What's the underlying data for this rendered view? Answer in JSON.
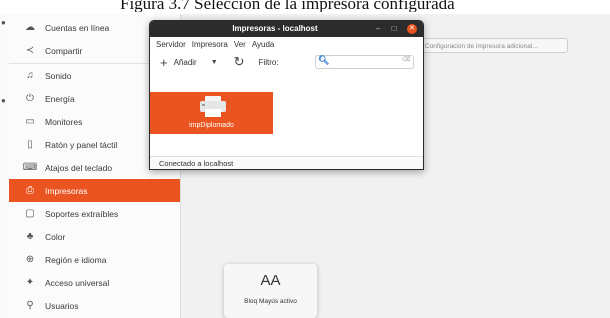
{
  "caption": "Figura 3.7 Selección de la impresora configurada",
  "sidebar": {
    "items": [
      {
        "label": "Cuentas en línea",
        "icon": "cloud-icon"
      },
      {
        "label": "Compartir",
        "icon": "share-icon"
      },
      {
        "label": "Sonido",
        "icon": "music-note-icon"
      },
      {
        "label": "Energía",
        "icon": "power-icon"
      },
      {
        "label": "Monitores",
        "icon": "monitor-icon"
      },
      {
        "label": "Ratón y panel táctil",
        "icon": "mouse-icon"
      },
      {
        "label": "Atajos del teclado",
        "icon": "keyboard-icon"
      },
      {
        "label": "Impresoras",
        "icon": "printer-icon"
      },
      {
        "label": "Soportes extraíbles",
        "icon": "removable-media-icon"
      },
      {
        "label": "Color",
        "icon": "color-icon"
      },
      {
        "label": "Región e idioma",
        "icon": "globe-icon"
      },
      {
        "label": "Acceso universal",
        "icon": "accessibility-icon"
      },
      {
        "label": "Usuarios",
        "icon": "users-icon"
      }
    ],
    "active_index": 7,
    "accent": "#e95420"
  },
  "main": {
    "additional_settings_label": "Configuración de impresora adicional..."
  },
  "printers_window": {
    "title": "Impresoras - localhost",
    "menu": [
      "Servidor",
      "Impresora",
      "Ver",
      "Ayuda"
    ],
    "toolbar": {
      "add_label": "Añadir",
      "filter_label": "Filtro:",
      "filter_value": ""
    },
    "printers": [
      {
        "name": "impDiplomado",
        "selected": true
      }
    ],
    "status": "Conectado a localhost"
  },
  "osd": {
    "symbol": "AA",
    "message": "Bloq Mayús activo"
  }
}
